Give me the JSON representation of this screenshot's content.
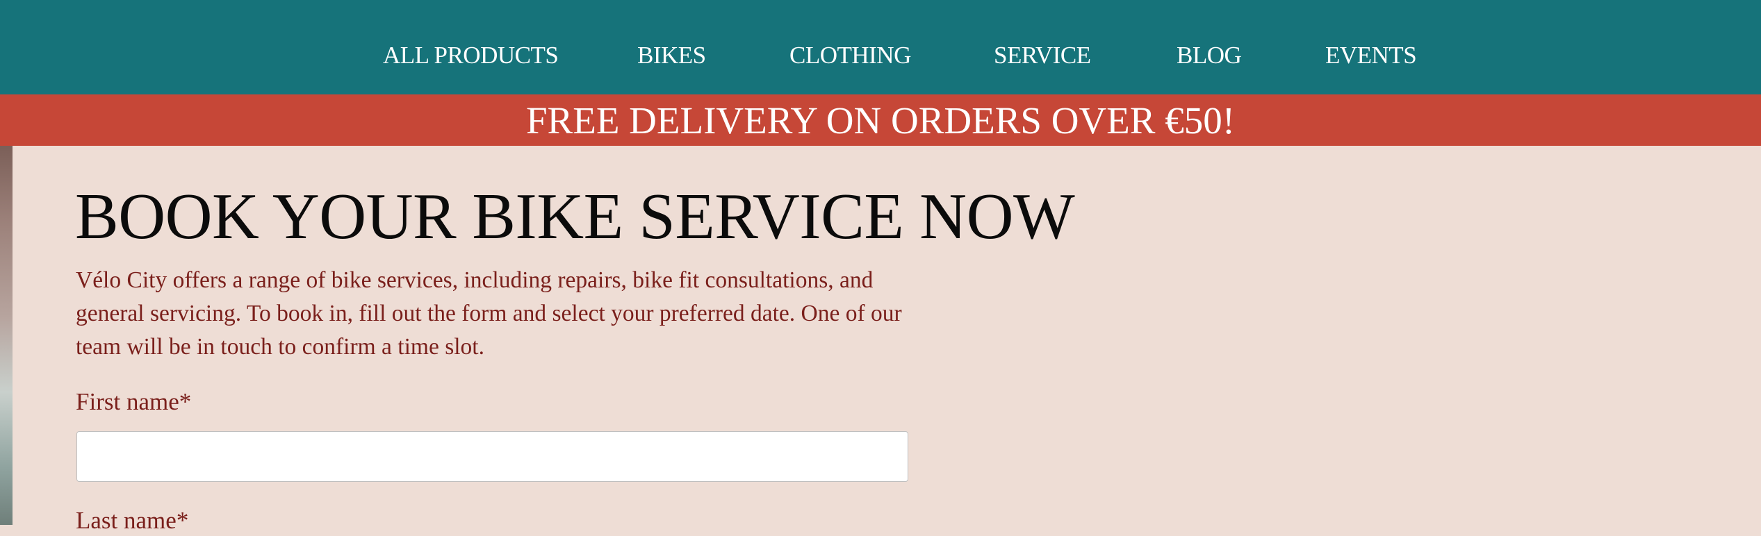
{
  "nav": {
    "items": [
      {
        "label": "ALL PRODUCTS"
      },
      {
        "label": "BIKES"
      },
      {
        "label": "CLOTHING"
      },
      {
        "label": "SERVICE"
      },
      {
        "label": "BLOG"
      },
      {
        "label": "EVENTS"
      }
    ]
  },
  "banner": {
    "text": "FREE DELIVERY ON ORDERS OVER €50!"
  },
  "main": {
    "title": "BOOK YOUR BIKE SERVICE NOW",
    "intro": "Vélo City offers a range of bike services, including repairs, bike fit consultations, and general servicing. To book in, fill out the form and select your preferred date. One of our team will be in touch to confirm a time slot."
  },
  "form": {
    "first_name_label": "First name",
    "first_name_value": "",
    "last_name_label": "Last name",
    "required_marker": "*"
  },
  "colors": {
    "nav_bg": "#16737a",
    "banner_bg": "#c64737",
    "page_bg": "#eeddd5",
    "body_text": "#7a1f1b"
  }
}
